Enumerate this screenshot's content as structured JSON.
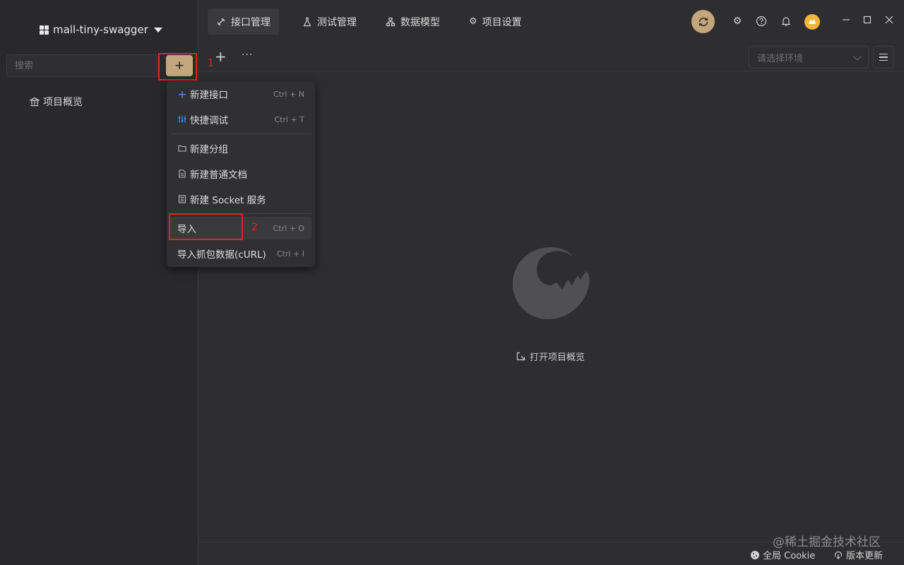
{
  "sidebar": {
    "project_name": "mall-tiny-swagger",
    "search_placeholder": "搜索",
    "add_button": "+",
    "overview_label": "项目概览"
  },
  "annotations": {
    "first": "1",
    "second": "2"
  },
  "menu": {
    "items": [
      {
        "label": "新建接口",
        "shortcut": "Ctrl + N",
        "icon": "plus-icon"
      },
      {
        "label": "快捷调试",
        "shortcut": "Ctrl + T",
        "icon": "debug-icon"
      },
      {
        "label": "新建分组",
        "shortcut": "",
        "icon": "folder-icon"
      },
      {
        "label": "新建普通文档",
        "shortcut": "",
        "icon": "document-icon"
      },
      {
        "label": "新建 Socket 服务",
        "shortcut": "",
        "icon": "socket-icon"
      },
      {
        "label": "导入",
        "shortcut": "Ctrl + O",
        "icon": ""
      },
      {
        "label": "导入抓包数据(cURL)",
        "shortcut": "Ctrl + I",
        "icon": ""
      }
    ]
  },
  "tabs": [
    {
      "label": "接口管理",
      "icon": "api-icon",
      "active": true
    },
    {
      "label": "测试管理",
      "icon": "flask-icon",
      "active": false
    },
    {
      "label": "数据模型",
      "icon": "model-icon",
      "active": false
    },
    {
      "label": "项目设置",
      "icon": "gear-icon",
      "active": false
    }
  ],
  "toolbar": {
    "plus": "+",
    "more": "···"
  },
  "env_select": {
    "placeholder": "请选择环境"
  },
  "main": {
    "open_overview": "打开项目概览"
  },
  "footer": {
    "cookie": "全局 Cookie",
    "update": "版本更新"
  },
  "watermark": "@稀土掘金技术社区",
  "colors": {
    "accent": "#c4a67c",
    "annotation_red": "#e02424",
    "background": "#2e2e30"
  }
}
